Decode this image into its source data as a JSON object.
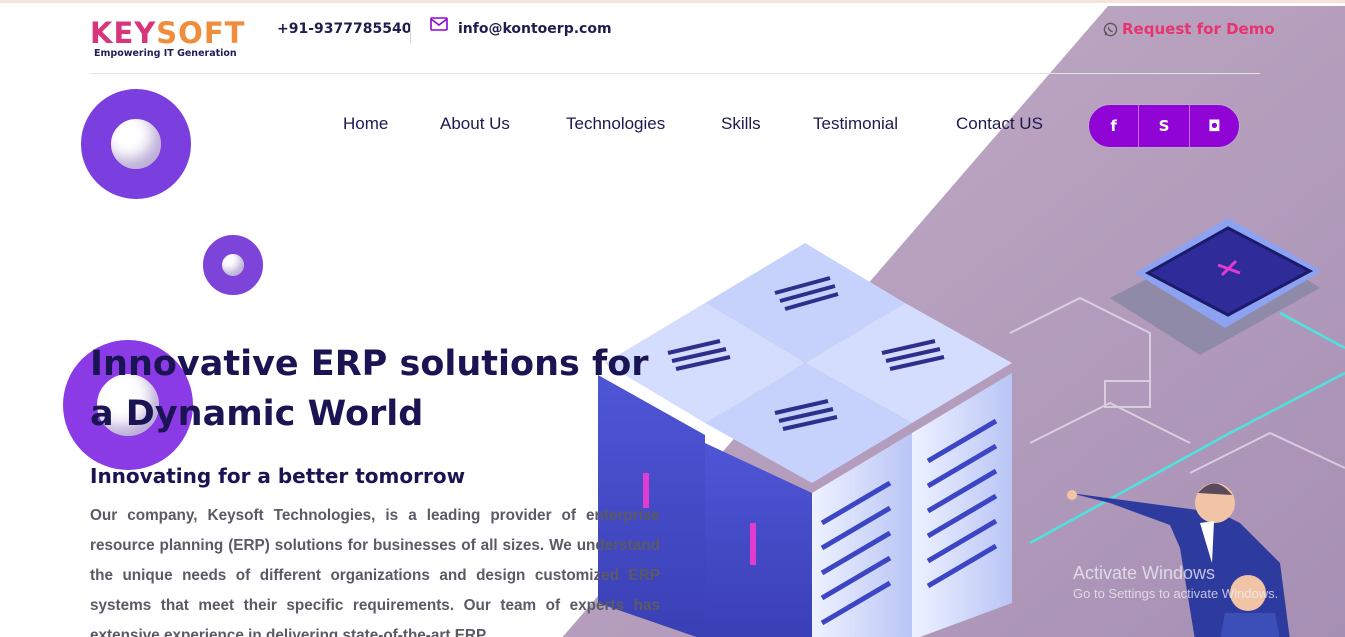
{
  "brand": {
    "logo_left": "KEY",
    "logo_right": "SOFT",
    "tagline": "Empowering IT Generation"
  },
  "topbar": {
    "phone": "+91-9377785540",
    "email": "info@kontoerp.com",
    "demo_label": "Request for Demo"
  },
  "nav": {
    "items": [
      {
        "label": "Home"
      },
      {
        "label": "About Us"
      },
      {
        "label": "Technologies"
      },
      {
        "label": "Skills"
      },
      {
        "label": "Testimonial"
      },
      {
        "label": "Contact US"
      }
    ]
  },
  "social": [
    {
      "icon": "facebook-icon",
      "glyph": "f"
    },
    {
      "icon": "skype-icon",
      "glyph": "S"
    },
    {
      "icon": "instagram-icon",
      "glyph": "◘"
    }
  ],
  "hero": {
    "title": "Innovative ERP solutions for a Dynamic World",
    "subtitle": "Innovating for a better tomorrow",
    "paragraph": "Our company, Keysoft Technologies, is a leading provider of enterprise resource planning (ERP) solutions for businesses of all sizes. We understand the unique needs of different organizations and design customized ERP systems that meet their specific requirements. Our team of experts has extensive experience in delivering state-of-the-art ERP"
  },
  "watermark": {
    "line1": "Activate Windows",
    "line2": "Go to Settings to activate Windows."
  },
  "colors": {
    "accent": "#9004d6",
    "brand_pink": "#e8336d",
    "navy": "#1b1453",
    "panel": "#b4a0bd"
  }
}
